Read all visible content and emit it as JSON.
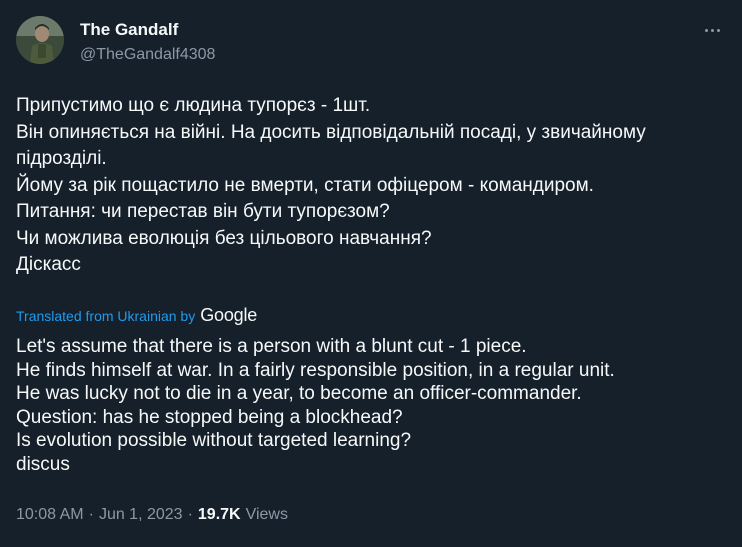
{
  "author": {
    "display_name": "The Gandalf",
    "handle": "@TheGandalf4308"
  },
  "tweet": {
    "original_lines": [
      "Припустимо що є людина тупорєз - 1шт.",
      "Він опиняється на війні. На досить відповідальній посаді, у звичайному",
      "підрозділі.",
      "Йому за рік пощастило не вмерти, стати офіцером - командиром.",
      "Питання: чи перестав він бути тупорєзом?",
      "Чи можлива еволюція без цільового навчання?",
      "Діскасс"
    ],
    "translated_from": "Translated from Ukrainian by",
    "translator": "Google",
    "translation_lines": [
      "Let's assume that there is a person with a blunt cut - 1 piece.",
      "He finds himself at war. In a fairly responsible position, in a regular unit.",
      "He was lucky not to die in a year, to become an officer-commander.",
      "Question: has he stopped being a blockhead?",
      "Is evolution possible without targeted learning?",
      "discus"
    ]
  },
  "meta": {
    "time": "10:08 AM",
    "date": "Jun 1, 2023",
    "views_count": "19.7K",
    "views_label": "Views",
    "separator": "·"
  },
  "icons": {
    "more": "more-horizontal-icon"
  },
  "colors": {
    "background": "#15202b",
    "text": "#f7f9f9",
    "secondary": "#8b98a5",
    "link": "#1d9bf0"
  }
}
